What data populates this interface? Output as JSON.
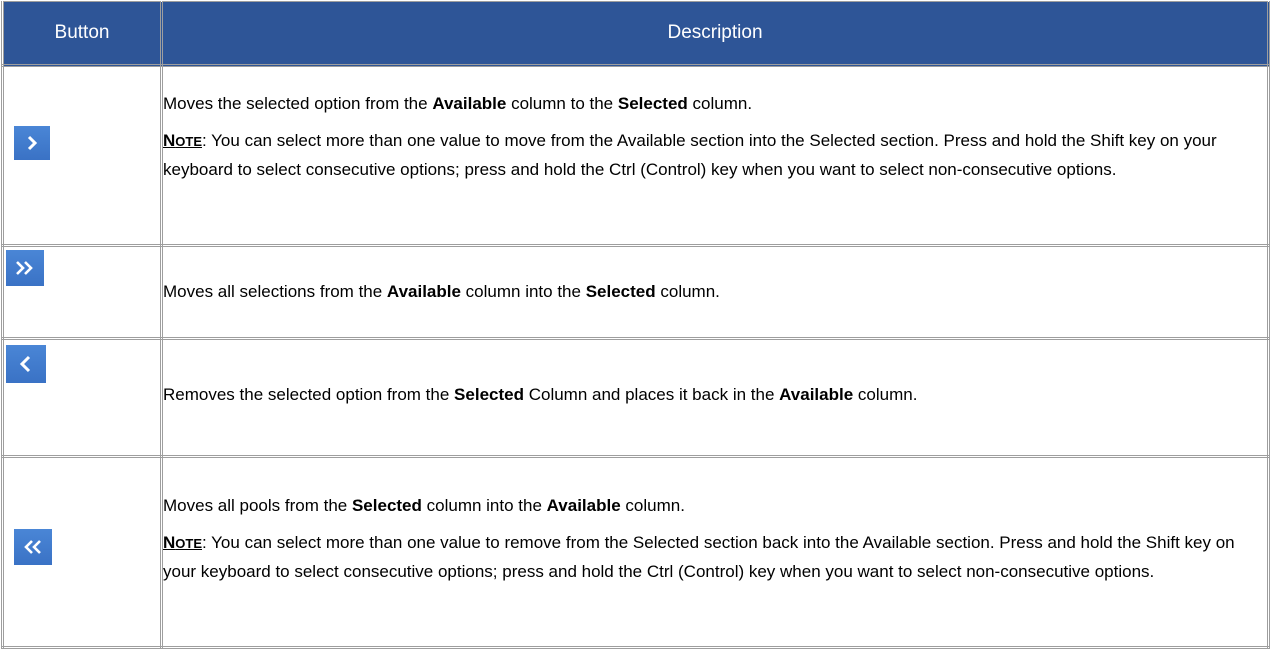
{
  "table": {
    "headers": {
      "button": "Button",
      "description": "Description"
    },
    "rows": [
      {
        "icon": "chevron-right-icon",
        "line_parts": [
          "Moves the selected option from the ",
          "Available",
          " column to the ",
          "Selected",
          " column."
        ],
        "note": {
          "label_first": "N",
          "label_rest": "OTE",
          "text": ":  You can select more than one value to move from the Available section into the Selected section.  Press and hold the Shift key on your keyboard to select consecutive options; press and hold the Ctrl (Control) key when you want to select non-consecutive options."
        }
      },
      {
        "icon": "double-chevron-right-icon",
        "line_parts": [
          "Moves all selections from the ",
          "Available",
          " column into the ",
          "Selected",
          " column."
        ]
      },
      {
        "icon": "chevron-left-icon",
        "line_parts": [
          "Removes the selected option from the ",
          "Selected",
          " Column and places it back in the ",
          "Available",
          " column."
        ]
      },
      {
        "icon": "double-chevron-left-icon",
        "line_parts": [
          "Moves all pools from the ",
          "Selected",
          " column into the ",
          "Available",
          " column."
        ],
        "note": {
          "label_first": "N",
          "label_rest": "OTE",
          "text": ":  You can select more than one value to remove from the Selected section back into the Available section.  Press and hold the Shift key on your keyboard to select consecutive options; press and hold the Ctrl (Control) key when you want to select non-consecutive options."
        }
      }
    ]
  },
  "colors": {
    "header_bg": "#2e5597",
    "button_bg": "#3d78c9",
    "border": "#9e9e9e"
  }
}
